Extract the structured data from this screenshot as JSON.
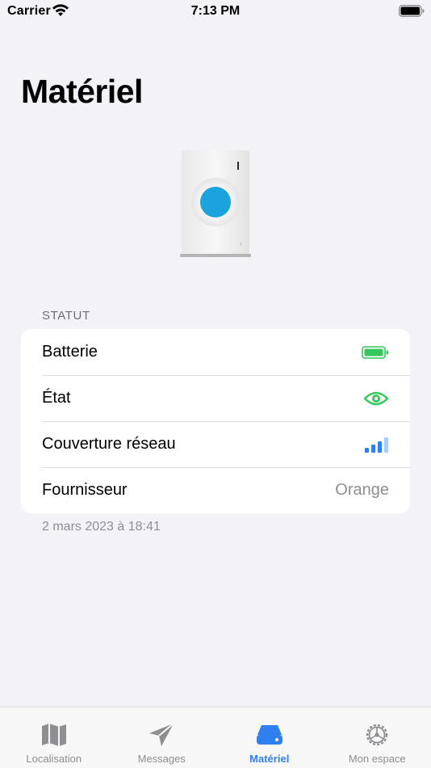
{
  "status_bar": {
    "carrier": "Carrier",
    "time": "7:13 PM"
  },
  "page": {
    "title": "Matériel"
  },
  "status": {
    "header": "STATUT",
    "rows": [
      {
        "label": "Batterie",
        "icon": "battery-full-icon"
      },
      {
        "label": "État",
        "icon": "eye-icon"
      },
      {
        "label": "Couverture réseau",
        "icon": "signal-bars-icon"
      },
      {
        "label": "Fournisseur",
        "value": "Orange"
      }
    ],
    "timestamp": "2 mars 2023 à 18:41"
  },
  "tabs": [
    {
      "label": "Localisation",
      "icon": "map-icon",
      "active": false
    },
    {
      "label": "Messages",
      "icon": "paper-plane-icon",
      "active": false
    },
    {
      "label": "Matériel",
      "icon": "drive-icon",
      "active": true
    },
    {
      "label": "Mon espace",
      "icon": "gear-icon",
      "active": false
    }
  ],
  "colors": {
    "accent": "#2f7ff0",
    "green": "#34c759",
    "background": "#f2f2f7",
    "device_dot": "#1aa3dc"
  }
}
